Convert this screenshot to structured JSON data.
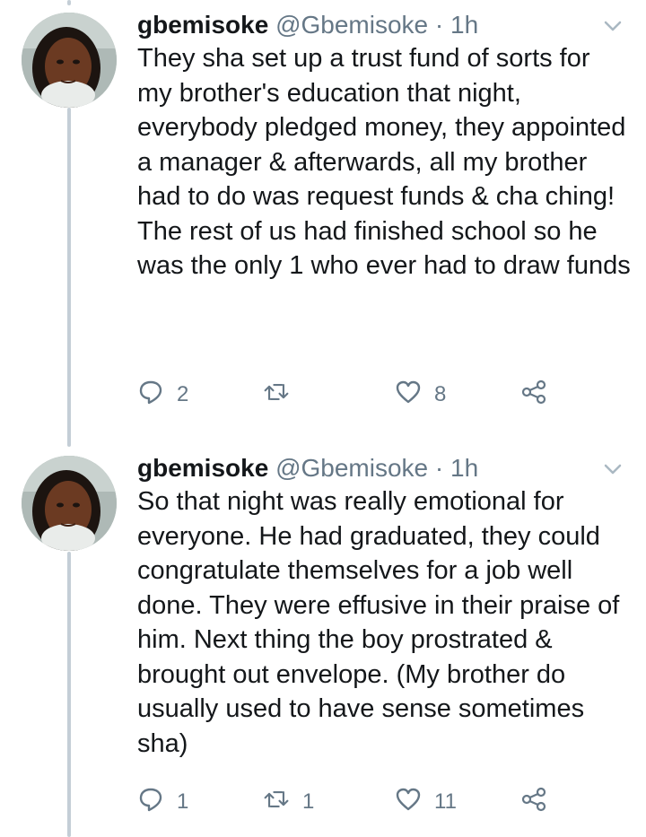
{
  "tweets": [
    {
      "name": "gbemisoke",
      "handle": "@Gbemisoke",
      "separator": "·",
      "time": "1h",
      "paragraphs": [
        "They sha set up a trust fund of sorts for my brother's education that night, everybody pledged money, they appointed a manager & afterwards, all my brother had to do was request funds & cha ching!",
        "The rest of us had finished school so he was the only 1 who ever had to draw funds"
      ],
      "reply_count": "2",
      "retweet_count": "",
      "like_count": "8"
    },
    {
      "name": "gbemisoke",
      "handle": "@Gbemisoke",
      "separator": "·",
      "time": "1h",
      "paragraphs": [
        "So that night was really emotional for everyone. He had graduated, they could congratulate themselves for a job well done. They were effusive in their praise of him. Next thing the boy prostrated & brought out envelope. (My brother do usually used to have sense sometimes sha)"
      ],
      "reply_count": "1",
      "retweet_count": "1",
      "like_count": "11"
    }
  ],
  "icons": {
    "reply": "reply-icon",
    "retweet": "retweet-icon",
    "like": "heart-icon",
    "share": "share-icon",
    "menu": "chevron-down-icon"
  },
  "colors": {
    "text": "#14171a",
    "muted": "#657786",
    "thread_line": "#c4ced6"
  }
}
